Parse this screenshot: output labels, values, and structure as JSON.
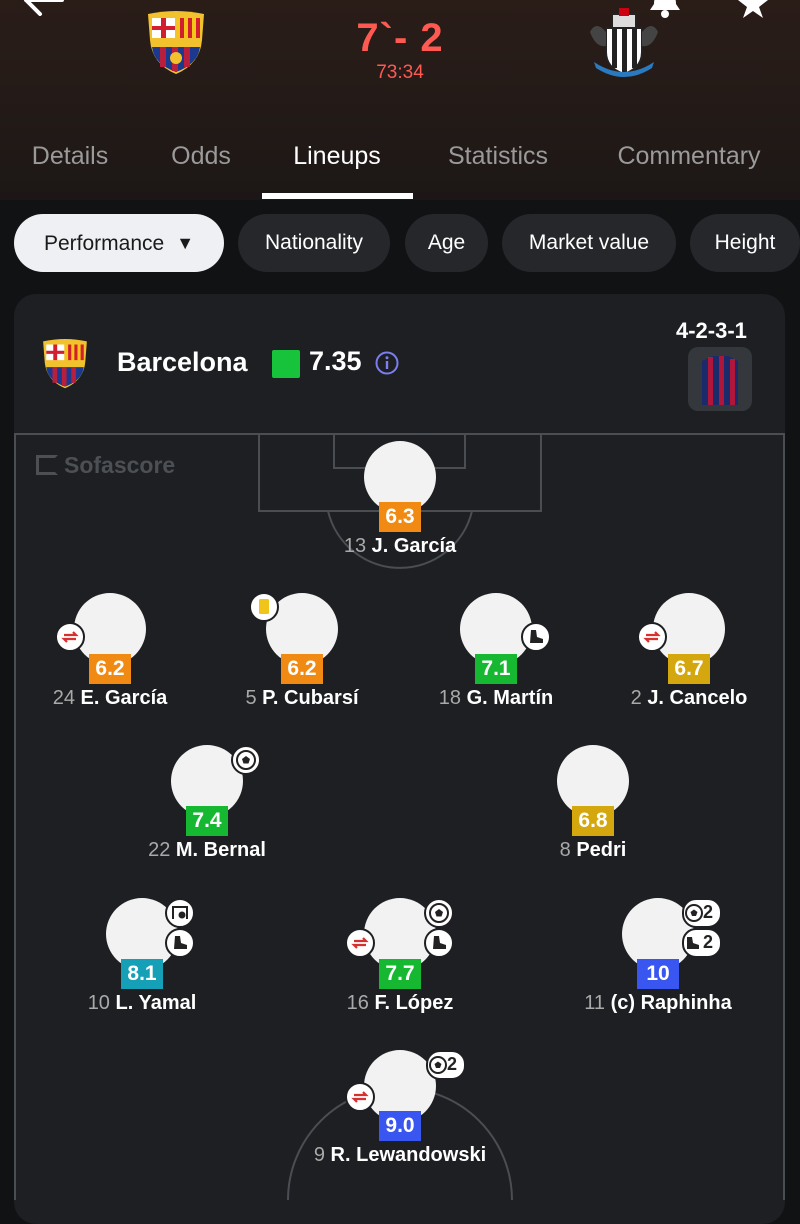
{
  "match": {
    "score": "7`- 2",
    "clock": "73:34"
  },
  "tabs": [
    "Details",
    "Odds",
    "Lineups",
    "Statistics",
    "Commentary"
  ],
  "active_tab": "Lineups",
  "filters": {
    "selected": "Performance",
    "options": [
      "Nationality",
      "Age",
      "Market value",
      "Height"
    ]
  },
  "team": {
    "name": "Barcelona",
    "average_rating": "7.35",
    "formation": "4-2-3-1",
    "watermark": "Sofascore"
  },
  "colors": {
    "rating_orange": "#f08a12",
    "rating_green": "#16b832",
    "rating_yellow": "#d4a70e",
    "rating_cyan": "#15a0b8",
    "rating_blue": "#3a56f0",
    "score_red": "#ff5a52"
  },
  "players": [
    {
      "number": "13",
      "name": "J. García",
      "rating": "6.3"
    },
    {
      "number": "24",
      "name": "E. García",
      "rating": "6.2"
    },
    {
      "number": "5",
      "name": "P. Cubarsí",
      "rating": "6.2"
    },
    {
      "number": "18",
      "name": "G. Martín",
      "rating": "7.1"
    },
    {
      "number": "2",
      "name": "J. Cancelo",
      "rating": "6.7"
    },
    {
      "number": "22",
      "name": "M. Bernal",
      "rating": "7.4"
    },
    {
      "number": "8",
      "name": "Pedri",
      "rating": "6.8"
    },
    {
      "number": "10",
      "name": "L. Yamal",
      "rating": "8.1"
    },
    {
      "number": "16",
      "name": "F. López",
      "rating": "7.7"
    },
    {
      "number": "11",
      "name": "(c) Raphinha",
      "rating": "10"
    },
    {
      "number": "9",
      "name": "R. Lewandowski",
      "rating": "9.0"
    }
  ],
  "event_counts": {
    "raphinha_goals": "2",
    "raphinha_assists": "2",
    "lewandowski_goals": "2"
  }
}
